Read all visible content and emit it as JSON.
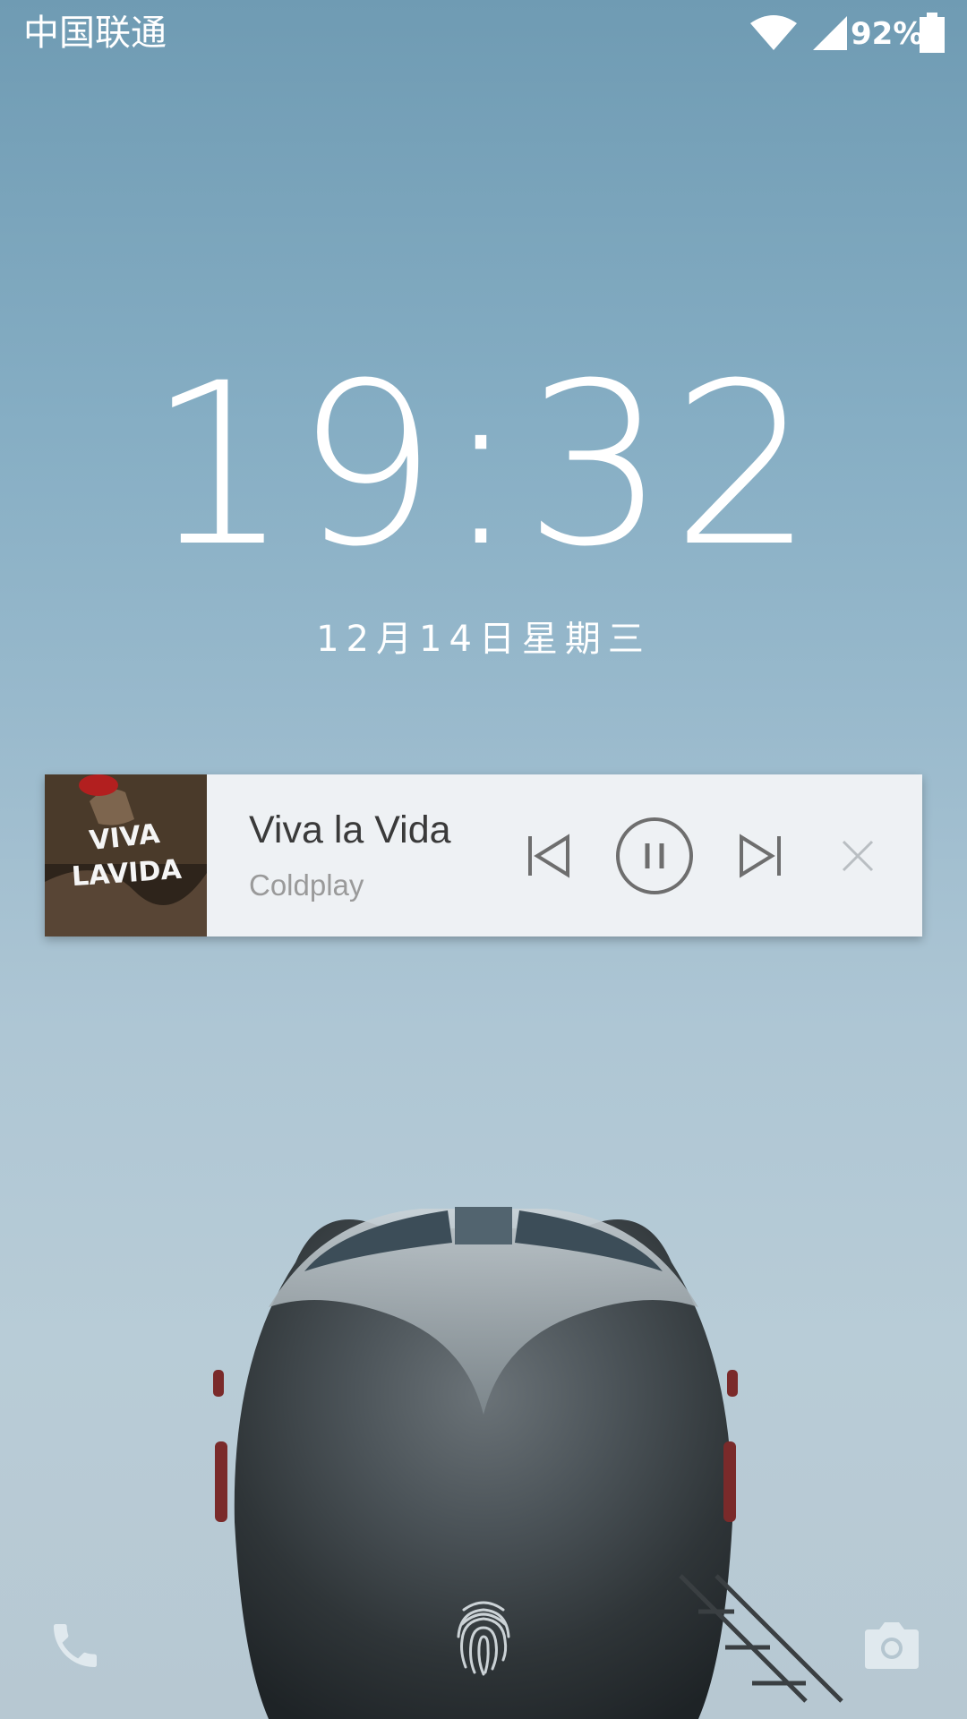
{
  "status_bar": {
    "carrier": "中国联通",
    "battery_percent": "92%",
    "wifi_icon": "wifi-icon",
    "signal_icon": "cell-signal-icon",
    "battery_icon": "battery-icon"
  },
  "lockscreen": {
    "time": "19:32",
    "date": "12月14日星期三"
  },
  "media_notification": {
    "title": "Viva la Vida",
    "artist": "Coldplay",
    "album_art_text": "VIVA LA VIDA",
    "controls": {
      "previous_icon": "skip-previous-icon",
      "pause_icon": "pause-icon",
      "next_icon": "skip-next-icon",
      "close_icon": "close-icon"
    }
  },
  "shortcuts": {
    "left_icon": "phone-icon",
    "center_icon": "fingerprint-icon",
    "right_icon": "camera-icon"
  },
  "colors": {
    "text_white": "#ffffff",
    "card_background": "#eef1f4",
    "title_text": "#3a3a3a",
    "artist_text": "#9a9a9a",
    "control_gray": "#6e6e6e"
  }
}
